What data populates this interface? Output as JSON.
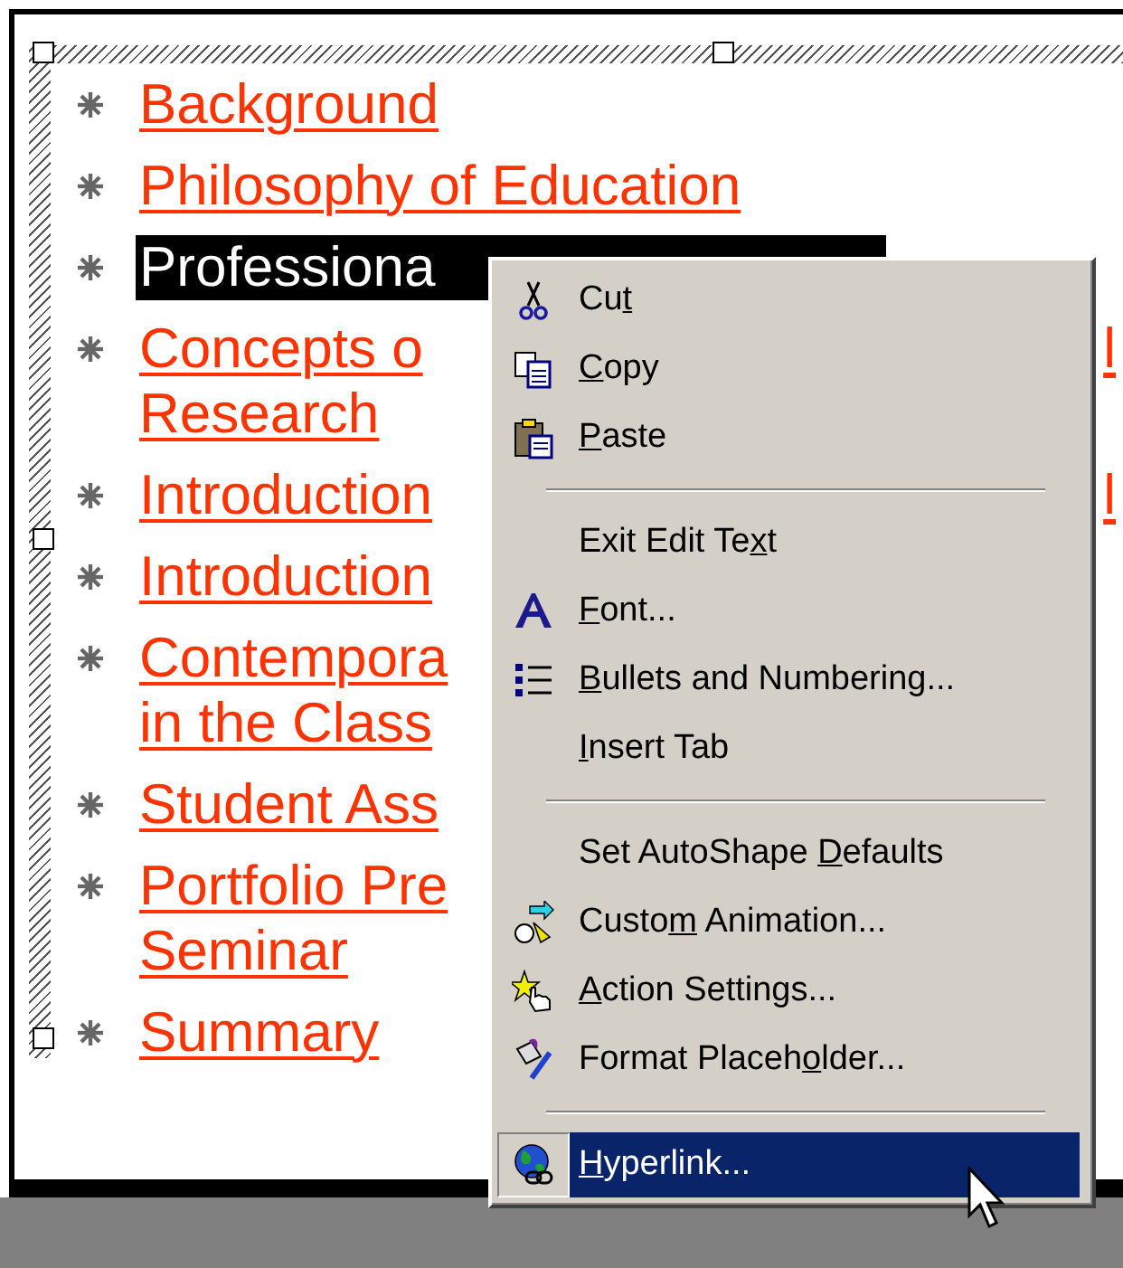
{
  "slide": {
    "bullets": [
      {
        "lines": [
          "Background"
        ],
        "selected": false
      },
      {
        "lines": [
          "Philosophy of Education"
        ],
        "selected": false
      },
      {
        "lines": [
          "Professiona"
        ],
        "selected": true
      },
      {
        "lines": [
          "Concepts o",
          "Research"
        ],
        "selected": false,
        "right_fragment": "l"
      },
      {
        "lines": [
          "Introduction"
        ],
        "selected": false,
        "right_fragment": "l"
      },
      {
        "lines": [
          "Introduction"
        ],
        "selected": false
      },
      {
        "lines": [
          "Contempora",
          "in the Class"
        ],
        "selected": false
      },
      {
        "lines": [
          "Student Ass"
        ],
        "selected": false
      },
      {
        "lines": [
          "Portfolio Pre",
          "Seminar"
        ],
        "selected": false
      },
      {
        "lines": [
          "Summary"
        ],
        "selected": false
      }
    ]
  },
  "context_menu": {
    "items": [
      {
        "kind": "item",
        "text_before": "Cu",
        "access_key": "t",
        "selected": false
      },
      {
        "kind": "item",
        "access_key": "C",
        "text_after": "opy",
        "selected": false
      },
      {
        "kind": "item",
        "access_key": "P",
        "text_after": "aste",
        "selected": false
      },
      {
        "kind": "separator"
      },
      {
        "kind": "item",
        "text_before": "Exit Edit Te",
        "access_key": "x",
        "text_after": "t",
        "selected": false
      },
      {
        "kind": "item",
        "access_key": "F",
        "text_after": "ont...",
        "selected": false
      },
      {
        "kind": "item",
        "access_key": "B",
        "text_after": "ullets and Numbering...",
        "selected": false
      },
      {
        "kind": "item",
        "access_key": "I",
        "text_after": "nsert Tab",
        "selected": false
      },
      {
        "kind": "separator"
      },
      {
        "kind": "item",
        "text_before": "Set AutoShape ",
        "access_key": "D",
        "text_after": "efaults",
        "selected": false
      },
      {
        "kind": "item",
        "text_before": "Custo",
        "access_key": "m",
        "text_after": " Animation...",
        "selected": false
      },
      {
        "kind": "item",
        "access_key": "A",
        "text_after": "ction Settings...",
        "selected": false
      },
      {
        "kind": "item",
        "text_before": "Format Placeh",
        "access_key": "o",
        "text_after": "lder...",
        "selected": false
      },
      {
        "kind": "separator"
      },
      {
        "kind": "item",
        "access_key": "H",
        "text_after": "yperlink...",
        "selected": true
      }
    ]
  }
}
